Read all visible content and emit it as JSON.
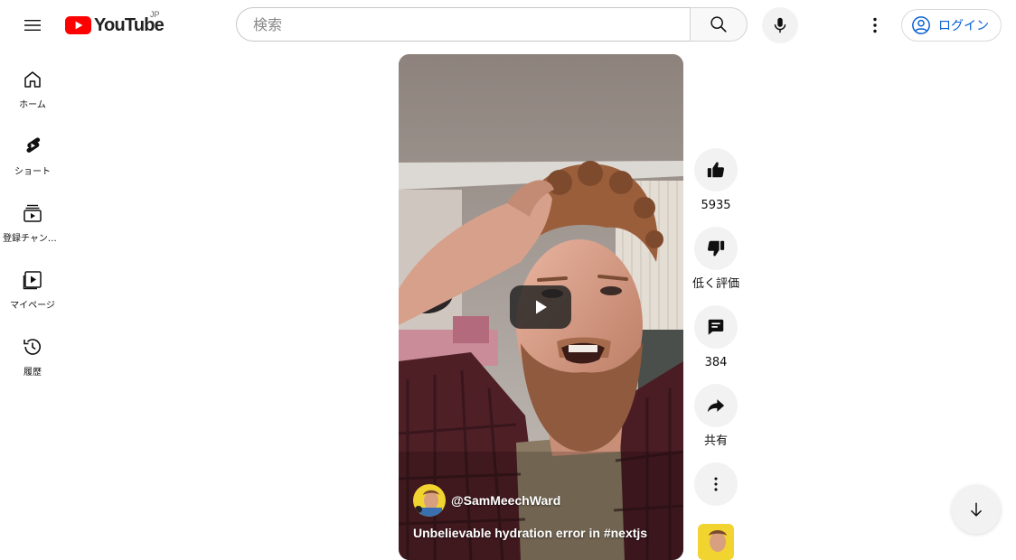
{
  "header": {
    "logo_text": "YouTube",
    "region": "JP",
    "search_placeholder": "検索",
    "login_label": "ログイン",
    "icons": {
      "menu": "hamburger-menu-icon",
      "search": "search-icon",
      "mic": "microphone-icon",
      "more": "more-vert-icon",
      "account": "account-circle-icon"
    }
  },
  "sidebar": {
    "items": [
      {
        "label": "ホーム",
        "icon": "home-icon"
      },
      {
        "label": "ショート",
        "icon": "shorts-icon"
      },
      {
        "label": "登録チャンネル",
        "icon": "subscriptions-icon"
      },
      {
        "label": "マイページ",
        "icon": "library-icon"
      },
      {
        "label": "履歴",
        "icon": "history-icon"
      }
    ]
  },
  "video": {
    "channel": "@SamMeechWard",
    "title": "Unbelievable hydration error in #nextjs"
  },
  "actions": {
    "likes": "5935",
    "dislike_label": "低く評価",
    "comments": "384",
    "share_label": "共有"
  },
  "colors": {
    "brand_red": "#ff0000",
    "link_blue": "#065fd4",
    "button_bg": "#f2f2f2"
  }
}
